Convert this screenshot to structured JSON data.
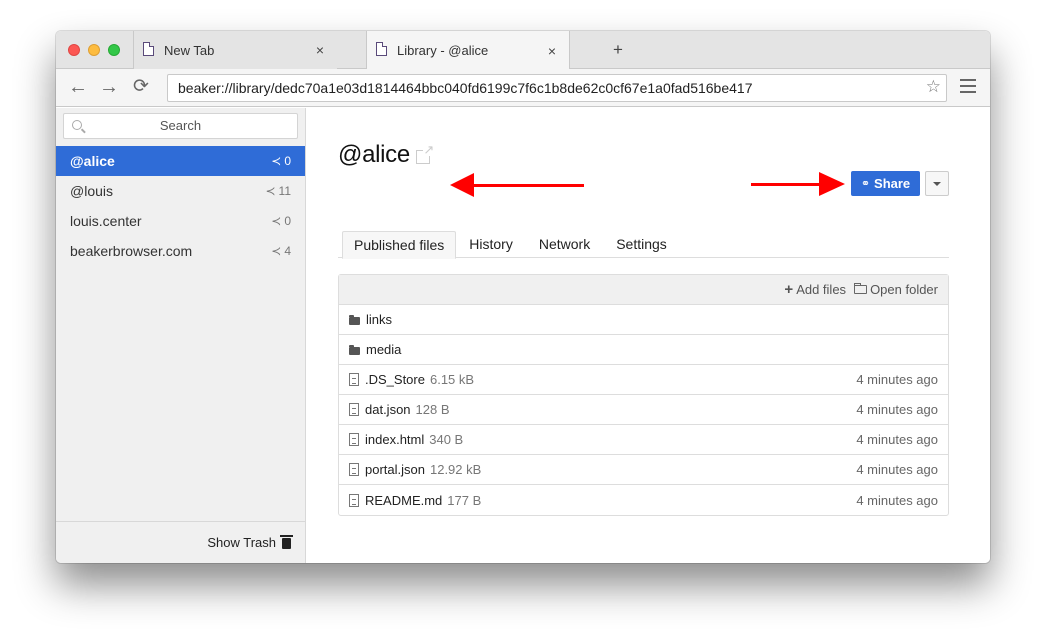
{
  "browser": {
    "tabs": [
      {
        "label": "New Tab",
        "close": "×"
      },
      {
        "label": "Library - @alice",
        "close": "×"
      }
    ],
    "new_tab": "+",
    "nav": {
      "back": "←",
      "forward": "→",
      "reload": "⟳"
    },
    "url": "beaker://library/dedc70a1e03d1814464bbc040fd6199c7f6c1b8de62c0cf67e1a0fad516be417",
    "bookmark": "☆"
  },
  "sidebar": {
    "search_placeholder": "Search",
    "items": [
      {
        "name": "@alice",
        "peers": "0",
        "active": true
      },
      {
        "name": "@louis",
        "peers": "11"
      },
      {
        "name": "louis.center",
        "peers": "0"
      },
      {
        "name": "beakerbrowser.com",
        "peers": "4"
      }
    ],
    "share_glyph": "≺",
    "footer": {
      "label": "Show Trash"
    }
  },
  "main": {
    "title": "@alice",
    "share_label": "Share",
    "share_glyph": "⚭",
    "tabs": [
      {
        "label": "Published files",
        "active": true
      },
      {
        "label": "History"
      },
      {
        "label": "Network"
      },
      {
        "label": "Settings"
      }
    ],
    "files_header": {
      "add_files": "Add files",
      "add_glyph": "+",
      "open_folder": "Open folder"
    },
    "files": [
      {
        "type": "folder",
        "name": "links",
        "size": "",
        "date": ""
      },
      {
        "type": "folder",
        "name": "media",
        "size": "",
        "date": ""
      },
      {
        "type": "file",
        "name": ".DS_Store",
        "size": "6.15 kB",
        "date": "4 minutes ago"
      },
      {
        "type": "file",
        "name": "dat.json",
        "size": "128 B",
        "date": "4 minutes ago"
      },
      {
        "type": "file",
        "name": "index.html",
        "size": "340 B",
        "date": "4 minutes ago"
      },
      {
        "type": "file",
        "name": "portal.json",
        "size": "12.92 kB",
        "date": "4 minutes ago"
      },
      {
        "type": "file",
        "name": "README.md",
        "size": "177 B",
        "date": "4 minutes ago"
      }
    ]
  },
  "colors": {
    "accent": "#2f6cd7",
    "annotation_arrow": "#ff0000"
  }
}
